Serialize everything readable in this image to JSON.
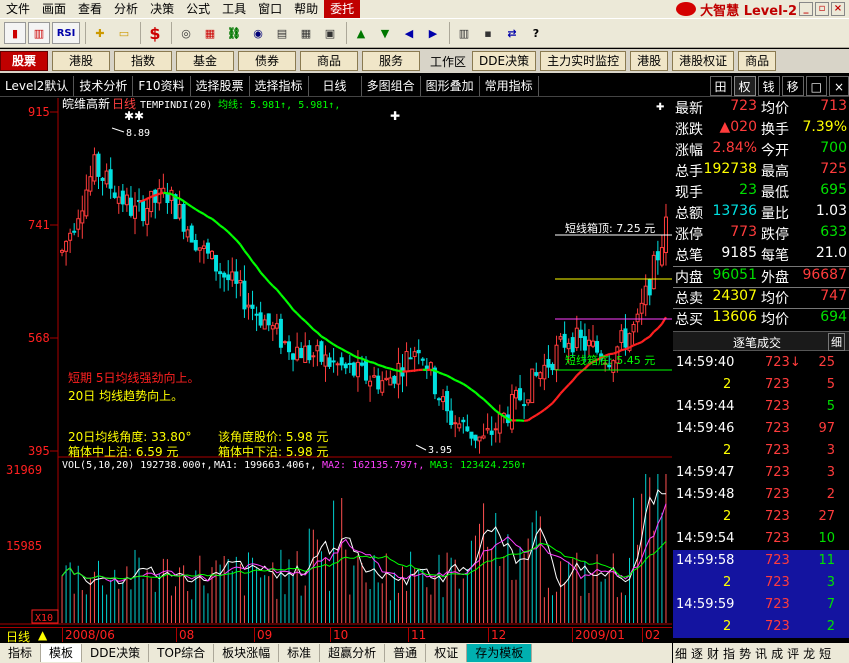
{
  "menu": [
    "文件",
    "画面",
    "查看",
    "分析",
    "决策",
    "公式",
    "工具",
    "窗口",
    "帮助",
    "委托"
  ],
  "brand": "大智慧 Level-2",
  "toolbar": {
    "rsi": "RSI",
    "dollar": "$"
  },
  "nav": {
    "buttons": [
      "股票",
      "港股",
      "指数",
      "基金",
      "债券",
      "商品",
      "服务"
    ],
    "workspace": "工作区",
    "right_buttons": [
      "DDE决策",
      "主力实时监控",
      "港股",
      "港股权证",
      "商品"
    ]
  },
  "subbar": {
    "items": [
      "Level2默认",
      "技术分析",
      "F10资料",
      "选择股票",
      "选择指标",
      "日线",
      "多图组合",
      "图形叠加",
      "常用指标"
    ],
    "right": [
      "田",
      "权",
      "钱",
      "移",
      "□",
      "×"
    ]
  },
  "chart": {
    "title": "皖维高新",
    "period": "日线",
    "indicator": "TEMPINDI(20)",
    "ma_label": "均线: 5.981↑, 5.981↑,",
    "y_axis": [
      "915",
      "741",
      "568",
      "395"
    ],
    "high_label": "8.89",
    "low_label": "3.95",
    "box_top": "短线箱顶: 7.25 元",
    "box_bottom": "短线箱底: 5.45 元",
    "signal1": "短期 5日均线强劲向上。",
    "signal2": "20日 均线趋势向上。",
    "angle_label": "20日均线角度: 33.80°",
    "angle_price": "该角度股价: 5.98 元",
    "cut1": "箱体中上沿: 6.59 元",
    "cut2": "箱体中下沿: 5.98 元",
    "vol_label": "VOL(5,10,20) 192738.000↑, ",
    "ma1": "MA1: 199663.406↑,",
    "ma2": "MA2: 162135.797↑,",
    "ma3": "MA3: 123424.250↑",
    "vol_axis": [
      "31969",
      "15985"
    ],
    "vol_unit": "X10",
    "x_axis": [
      "2008/06",
      "08",
      "09",
      "10",
      "11",
      "12",
      "2009/01",
      "02"
    ],
    "period_tab": "日线"
  },
  "quote": {
    "rows": [
      {
        "l1": "最新",
        "v1": "723",
        "c1": "red",
        "l2": "均价",
        "v2": "713",
        "c2": "red"
      },
      {
        "l1": "涨跌",
        "v1": "▲020",
        "c1": "red",
        "l2": "换手",
        "v2": "7.39%",
        "c2": "yellow"
      },
      {
        "l1": "涨幅",
        "v1": "2.84%",
        "c1": "red",
        "l2": "今开",
        "v2": "700",
        "c2": "green"
      },
      {
        "l1": "总手",
        "v1": "192738",
        "c1": "yellow",
        "l2": "最高",
        "v2": "725",
        "c2": "red"
      },
      {
        "l1": "现手",
        "v1": "23",
        "c1": "green",
        "l2": "最低",
        "v2": "695",
        "c2": "green"
      },
      {
        "l1": "总额",
        "v1": "13736",
        "c1": "cyan",
        "l2": "量比",
        "v2": "1.03",
        "c2": "white"
      },
      {
        "l1": "涨停",
        "v1": "773",
        "c1": "red",
        "l2": "跌停",
        "v2": "633",
        "c2": "green"
      },
      {
        "l1": "总笔",
        "v1": "9185",
        "c1": "white",
        "l2": "每笔",
        "v2": "21.0",
        "c2": "white"
      },
      {
        "l1": "内盘",
        "v1": "96051",
        "c1": "green",
        "l2": "外盘",
        "v2": "96687",
        "c2": "red"
      },
      {
        "l1": "总卖",
        "v1": "24307",
        "c1": "yellow",
        "l2": "均价",
        "v2": "747",
        "c2": "red"
      },
      {
        "l1": "总买",
        "v1": "13606",
        "c1": "yellow",
        "l2": "均价",
        "v2": "694",
        "c2": "green"
      }
    ]
  },
  "ticks": {
    "title": "逐笔成交",
    "detail": "细",
    "rows": [
      {
        "t": "14:59:40",
        "p": "723↓",
        "v": "25",
        "c": "red",
        "hl": false
      },
      {
        "t": "2",
        "p": "723",
        "v": "5",
        "c": "red",
        "hl": false
      },
      {
        "t": "14:59:44",
        "p": "723",
        "v": "5",
        "c": "green",
        "hl": false
      },
      {
        "t": "14:59:46",
        "p": "723",
        "v": "97",
        "c": "red",
        "hl": false
      },
      {
        "t": "2",
        "p": "723",
        "v": "3",
        "c": "red",
        "hl": false
      },
      {
        "t": "14:59:47",
        "p": "723",
        "v": "3",
        "c": "red",
        "hl": false
      },
      {
        "t": "14:59:48",
        "p": "723",
        "v": "2",
        "c": "red",
        "hl": false
      },
      {
        "t": "2",
        "p": "723",
        "v": "27",
        "c": "red",
        "hl": false
      },
      {
        "t": "14:59:54",
        "p": "723",
        "v": "10",
        "c": "green",
        "hl": false
      },
      {
        "t": "14:59:58",
        "p": "723",
        "v": "11",
        "c": "green",
        "hl": true
      },
      {
        "t": "2",
        "p": "723",
        "v": "3",
        "c": "green",
        "hl": true
      },
      {
        "t": "14:59:59",
        "p": "723",
        "v": "7",
        "c": "green",
        "hl": true
      },
      {
        "t": "2",
        "p": "723",
        "v": "2",
        "c": "green",
        "hl": true
      }
    ]
  },
  "righttabs": [
    "细",
    "逐",
    "财",
    "指",
    "势",
    "讯",
    "成",
    "评",
    "龙",
    "短"
  ],
  "bottomtabs": [
    "指标",
    "模板",
    "DDE决策",
    "TOP综合",
    "板块涨幅",
    "标准",
    "超赢分析",
    "普通",
    "权证",
    "存为模板"
  ],
  "colors": {
    "up": "#ff3c3c",
    "down": "#00e0e0",
    "ma20_up": "#ff2020",
    "ma20_down": "#00ff00"
  }
}
